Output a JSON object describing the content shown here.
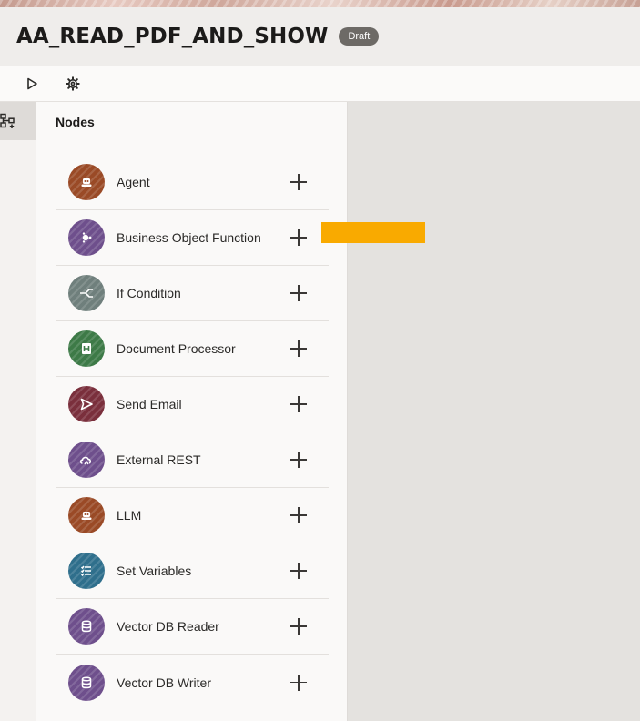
{
  "header": {
    "title": "AA_READ_PDF_AND_SHOW",
    "status_badge": "Draft"
  },
  "toolbar": {
    "run_icon": "play-icon",
    "settings_icon": "gear-icon"
  },
  "rail": {
    "nodes_icon": "hierarchy-add-icon"
  },
  "panel": {
    "title": "Nodes",
    "nodes": [
      {
        "label": "Agent",
        "icon": "agent-icon",
        "color": "#9a4a26"
      },
      {
        "label": "Business Object Function",
        "icon": "function-icon",
        "color": "#6e4f8c"
      },
      {
        "label": "If Condition",
        "icon": "branch-icon",
        "color": "#6f7f7c"
      },
      {
        "label": "Document Processor",
        "icon": "document-processor-icon",
        "color": "#3d7a47"
      },
      {
        "label": "Send Email",
        "icon": "send-icon",
        "color": "#7a2f3c"
      },
      {
        "label": "External REST",
        "icon": "cloud-rest-icon",
        "color": "#6e4f8c"
      },
      {
        "label": "LLM",
        "icon": "llm-icon",
        "color": "#9a4a26"
      },
      {
        "label": "Set Variables",
        "icon": "variables-list-icon",
        "color": "#2f6f8c"
      },
      {
        "label": "Vector DB Reader",
        "icon": "database-read-icon",
        "color": "#6e4f8c"
      },
      {
        "label": "Vector DB Writer",
        "icon": "database-write-icon",
        "color": "#6e4f8c"
      }
    ]
  },
  "colors": {
    "highlight": "#f9aa00",
    "badge": "#6d6a66",
    "canvas": "#e4e2df"
  }
}
